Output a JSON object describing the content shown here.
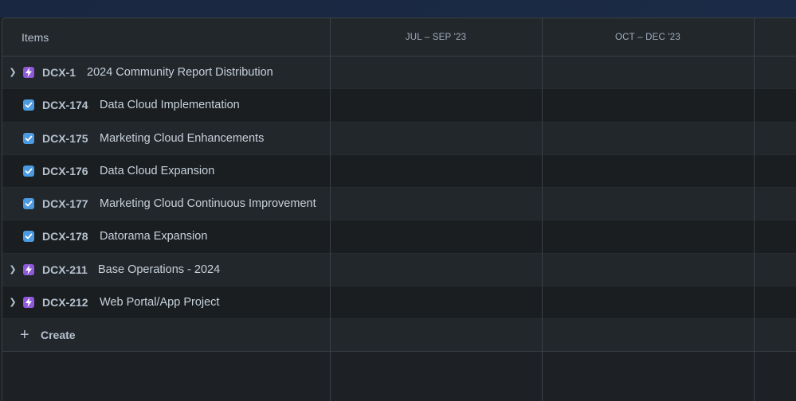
{
  "header": {
    "items_label": "Items",
    "periods": [
      "JUL – SEP '23",
      "OCT – DEC '23"
    ]
  },
  "rows": [
    {
      "key": "DCX-1",
      "title": "2024 Community Report Distribution",
      "type": "epic",
      "expandable": true
    },
    {
      "key": "DCX-174",
      "title": "Data Cloud Implementation",
      "type": "task",
      "expandable": false
    },
    {
      "key": "DCX-175",
      "title": "Marketing Cloud Enhancements",
      "type": "task",
      "expandable": false
    },
    {
      "key": "DCX-176",
      "title": "Data Cloud Expansion",
      "type": "task",
      "expandable": false
    },
    {
      "key": "DCX-177",
      "title": "Marketing Cloud Continuous Improvement",
      "type": "task",
      "expandable": false
    },
    {
      "key": "DCX-178",
      "title": "Datorama Expansion",
      "type": "task",
      "expandable": false
    },
    {
      "key": "DCX-211",
      "title": "Base Operations - 2024",
      "type": "epic",
      "expandable": true
    },
    {
      "key": "DCX-212",
      "title": "Web Portal/App Project",
      "type": "epic",
      "expandable": true
    }
  ],
  "create": {
    "label": "Create"
  },
  "colors": {
    "epic": "#8f59d9",
    "task": "#4c9ae0",
    "background": "#1d2125"
  }
}
